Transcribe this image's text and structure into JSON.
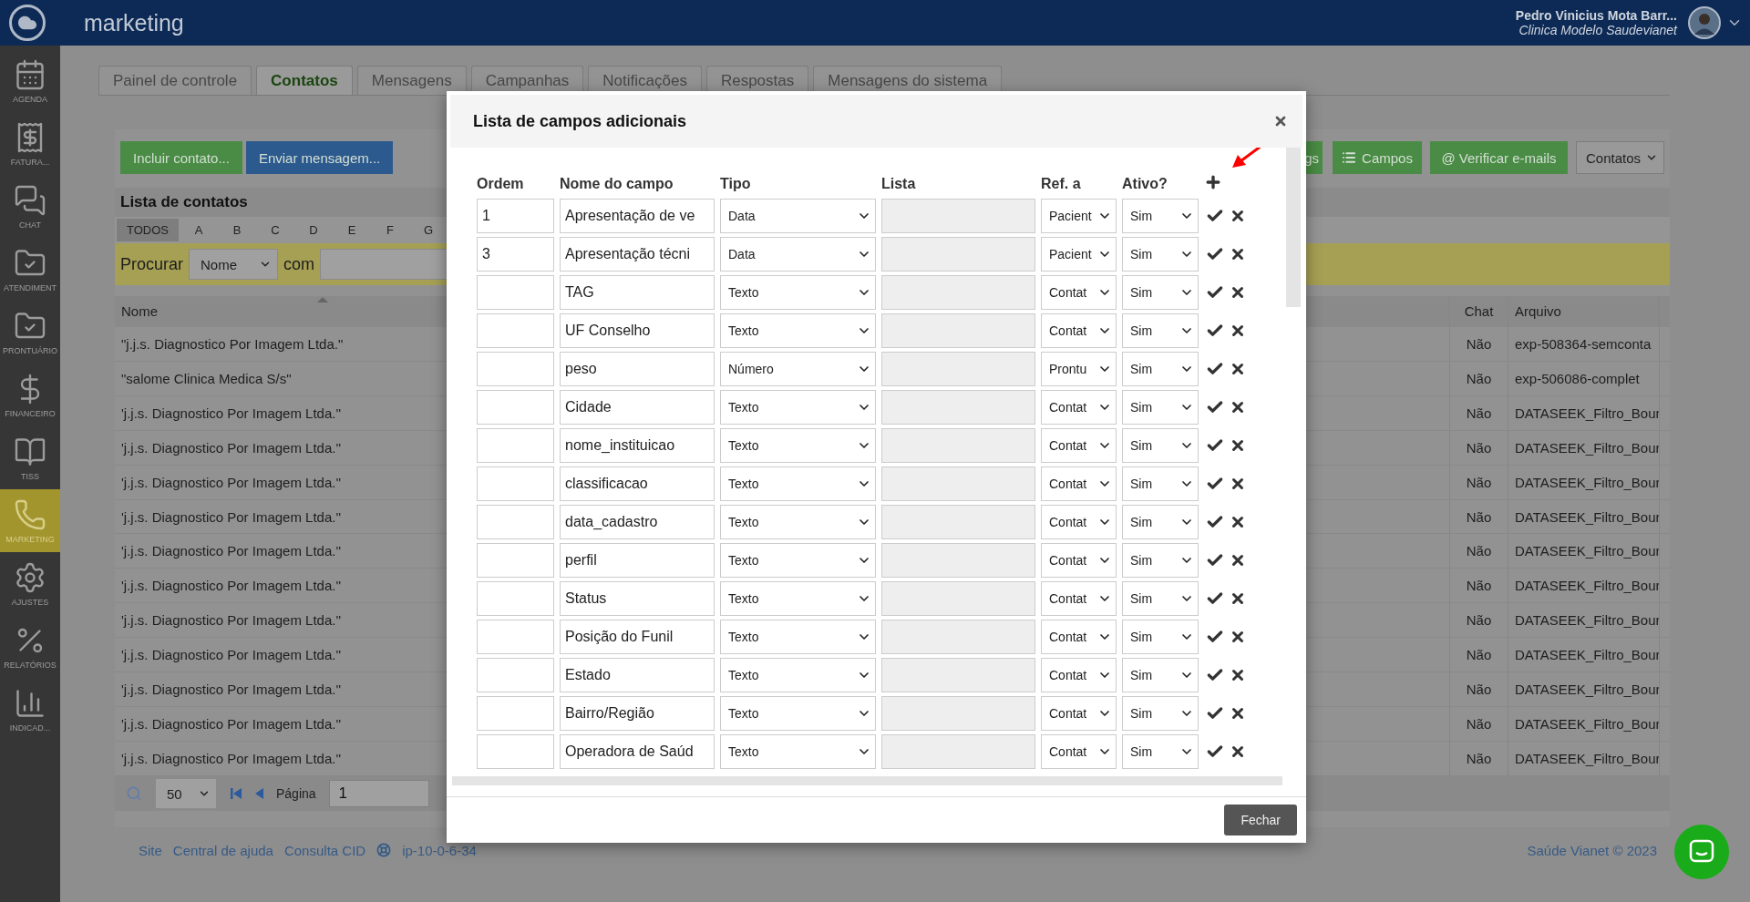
{
  "app": {
    "module_title": "marketing"
  },
  "user": {
    "name": "Pedro Vinicius Mota Barr...",
    "clinic": "Clinica Modelo Saudevianet"
  },
  "sidebar": {
    "items": [
      {
        "label": "AGENDA",
        "selected": false
      },
      {
        "label": "FATURA...",
        "selected": false
      },
      {
        "label": "CHAT",
        "selected": false
      },
      {
        "label": "ATENDIMENT",
        "selected": false
      },
      {
        "label": "PRONTUÁRIO",
        "selected": false
      },
      {
        "label": "FINANCEIRO",
        "selected": false
      },
      {
        "label": "TISS",
        "selected": false
      },
      {
        "label": "MARKETING",
        "selected": true
      },
      {
        "label": "AJUSTES",
        "selected": false
      },
      {
        "label": "RELATÓRIOS",
        "selected": false
      },
      {
        "label": "INDICAD...",
        "selected": false
      }
    ]
  },
  "tabs": [
    {
      "label": "Painel de controle",
      "selected": false
    },
    {
      "label": "Contatos",
      "selected": true
    },
    {
      "label": "Mensagens",
      "selected": false
    },
    {
      "label": "Campanhas",
      "selected": false
    },
    {
      "label": "Notificações",
      "selected": false
    },
    {
      "label": "Respostas",
      "selected": false
    },
    {
      "label": "Mensagens do sistema",
      "selected": false
    }
  ],
  "toolbar": {
    "left_buttons": [
      {
        "label": "Incluir contato...",
        "kind": "add"
      },
      {
        "label": "Enviar mensagem...",
        "kind": "send"
      }
    ],
    "right_buttons": [
      {
        "label": "gs",
        "kind": "text"
      },
      {
        "label": "Campos",
        "kind": "list"
      },
      {
        "label": "@ Verificar e-mails",
        "kind": "text"
      }
    ],
    "view_select": "Contatos"
  },
  "contact_list": {
    "title": "Lista de contatos",
    "letters": [
      {
        "label": "TODOS",
        "selected": true
      },
      {
        "label": "A",
        "selected": false
      },
      {
        "label": "B",
        "selected": false
      },
      {
        "label": "C",
        "selected": false
      },
      {
        "label": "D",
        "selected": false
      },
      {
        "label": "E",
        "selected": false
      },
      {
        "label": "F",
        "selected": false
      },
      {
        "label": "G",
        "selected": false
      }
    ],
    "search": {
      "label": "Procurar",
      "field": "Nome",
      "connector": "com"
    },
    "columns": [
      "Nome",
      "Chat",
      "Arquivo"
    ],
    "rows": [
      {
        "nome": "\"j.j.s. Diagnostico Por Imagem Ltda.\"",
        "chat": "Não",
        "arquivo": "exp-508364-semconta"
      },
      {
        "nome": "\"salome Clinica Medica S/s\"",
        "chat": "Não",
        "arquivo": "exp-506086-complet"
      },
      {
        "nome": "'j.j.s. Diagnostico Por Imagem Ltda.''",
        "chat": "Não",
        "arquivo": "DATASEEK_Filtro_Bour"
      },
      {
        "nome": "'j.j.s. Diagnostico Por Imagem Ltda.''",
        "chat": "Não",
        "arquivo": "DATASEEK_Filtro_Bour"
      },
      {
        "nome": "'j.j.s. Diagnostico Por Imagem Ltda.''",
        "chat": "Não",
        "arquivo": "DATASEEK_Filtro_Bour"
      },
      {
        "nome": "'j.j.s. Diagnostico Por Imagem Ltda.''",
        "chat": "Não",
        "arquivo": "DATASEEK_Filtro_Bour"
      },
      {
        "nome": "'j.j.s. Diagnostico Por Imagem Ltda.''",
        "chat": "Não",
        "arquivo": "DATASEEK_Filtro_Bour"
      },
      {
        "nome": "'j.j.s. Diagnostico Por Imagem Ltda.''",
        "chat": "Não",
        "arquivo": "DATASEEK_Filtro_Bour"
      },
      {
        "nome": "'j.j.s. Diagnostico Por Imagem Ltda.''",
        "chat": "Não",
        "arquivo": "DATASEEK_Filtro_Bour"
      },
      {
        "nome": "'j.j.s. Diagnostico Por Imagem Ltda.''",
        "chat": "Não",
        "arquivo": "DATASEEK_Filtro_Bour"
      },
      {
        "nome": "'j.j.s. Diagnostico Por Imagem Ltda.''",
        "chat": "Não",
        "arquivo": "DATASEEK_Filtro_Bour"
      },
      {
        "nome": "'j.j.s. Diagnostico Por Imagem Ltda.''",
        "chat": "Não",
        "arquivo": "DATASEEK_Filtro_Bour"
      },
      {
        "nome": "'j.j.s. Diagnostico Por Imagem Ltda.''",
        "chat": "Não",
        "arquivo": "DATASEEK_Filtro_Bour"
      }
    ],
    "pagination": {
      "page_size": "50",
      "page_label": "Página",
      "page": "1"
    }
  },
  "footer": {
    "links": [
      "Site",
      "Central de ajuda",
      "Consulta CID"
    ],
    "server": "ip-10-0-6-34",
    "copyright": "Saúde Vianet © 2023"
  },
  "modal": {
    "title": "Lista de campos adicionais",
    "columns": [
      "Ordem",
      "Nome do campo",
      "Tipo",
      "Lista",
      "Ref. a",
      "Ativo?"
    ],
    "rows": [
      {
        "ordem": "1",
        "nome": "Apresentação de ve",
        "tipo": "Data",
        "ref": "Pacient",
        "ativo": "Sim"
      },
      {
        "ordem": "3",
        "nome": "Apresentação técni",
        "tipo": "Data",
        "ref": "Pacient",
        "ativo": "Sim"
      },
      {
        "nome": "TAG",
        "tipo": "Texto",
        "ref": "Contat",
        "ativo": "Sim"
      },
      {
        "nome": "UF Conselho",
        "tipo": "Texto",
        "ref": "Contat",
        "ativo": "Sim"
      },
      {
        "nome": "peso",
        "tipo": "Número",
        "ref": "Prontu",
        "ativo": "Sim"
      },
      {
        "nome": "Cidade",
        "tipo": "Texto",
        "ref": "Contat",
        "ativo": "Sim"
      },
      {
        "nome": "nome_instituicao",
        "tipo": "Texto",
        "ref": "Contat",
        "ativo": "Sim"
      },
      {
        "nome": "classificacao",
        "tipo": "Texto",
        "ref": "Contat",
        "ativo": "Sim"
      },
      {
        "nome": "data_cadastro",
        "tipo": "Texto",
        "ref": "Contat",
        "ativo": "Sim"
      },
      {
        "nome": "perfil",
        "tipo": "Texto",
        "ref": "Contat",
        "ativo": "Sim"
      },
      {
        "nome": "Status",
        "tipo": "Texto",
        "ref": "Contat",
        "ativo": "Sim"
      },
      {
        "nome": "Posição do Funil",
        "tipo": "Texto",
        "ref": "Contat",
        "ativo": "Sim"
      },
      {
        "nome": "Estado",
        "tipo": "Texto",
        "ref": "Contat",
        "ativo": "Sim"
      },
      {
        "nome": "Bairro/Região",
        "tipo": "Texto",
        "ref": "Contat",
        "ativo": "Sim"
      },
      {
        "nome": "Operadora de Saúd",
        "tipo": "Texto",
        "ref": "Contat",
        "ativo": "Sim"
      }
    ],
    "close_button": "Fechar"
  }
}
